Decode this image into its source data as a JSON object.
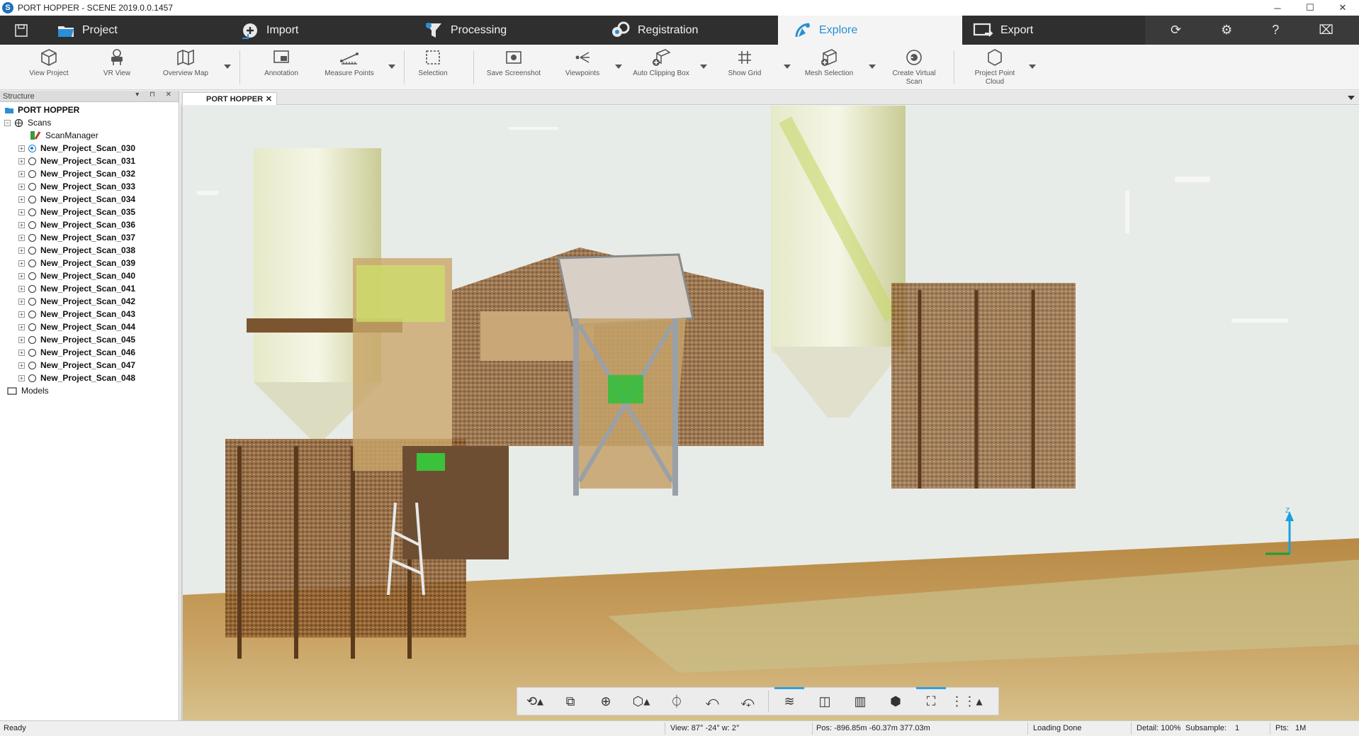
{
  "window": {
    "title": "PORT HOPPER - SCENE 2019.0.0.1457",
    "app_icon_letter": "S",
    "buttons": {
      "minimize": "─",
      "maximize": "☐",
      "close": "✕"
    }
  },
  "workflow": {
    "tabs": [
      {
        "label": "Project",
        "icon": "folder-icon"
      },
      {
        "label": "Import",
        "icon": "import-icon"
      },
      {
        "label": "Processing",
        "icon": "processing-icon"
      },
      {
        "label": "Registration",
        "icon": "registration-icon"
      },
      {
        "label": "Explore",
        "icon": "explore-icon",
        "active": true
      },
      {
        "label": "Export",
        "icon": "export-icon"
      }
    ],
    "right_tools": [
      "sync-icon",
      "gear-icon",
      "help-icon",
      "camera-icon"
    ],
    "accent_color": "#2a8fd6"
  },
  "ribbon": {
    "view_project": "View Project",
    "vr_view": "VR View",
    "overview_map": "Overview Map",
    "annotation": "Annotation",
    "measure_points": "Measure Points",
    "selection": "Selection",
    "save_screenshot": "Save Screenshot",
    "viewpoints": "Viewpoints",
    "auto_clipping_box": "Auto Clipping Box",
    "show_grid": "Show Grid",
    "mesh_selection": "Mesh Selection",
    "create_virtual_scan_1": "Create Virtual",
    "create_virtual_scan_2": "Scan",
    "project_point_cloud_1": "Project Point",
    "project_point_cloud_2": "Cloud"
  },
  "structure": {
    "title": "Structure",
    "header_buttons": "▾ ⊓ ✕",
    "root": "PORT HOPPER",
    "scans_folder": "Scans",
    "scan_manager": "ScanManager",
    "scans": [
      "New_Project_Scan_030",
      "New_Project_Scan_031",
      "New_Project_Scan_032",
      "New_Project_Scan_033",
      "New_Project_Scan_034",
      "New_Project_Scan_035",
      "New_Project_Scan_036",
      "New_Project_Scan_037",
      "New_Project_Scan_038",
      "New_Project_Scan_039",
      "New_Project_Scan_040",
      "New_Project_Scan_041",
      "New_Project_Scan_042",
      "New_Project_Scan_043",
      "New_Project_Scan_044",
      "New_Project_Scan_045",
      "New_Project_Scan_046",
      "New_Project_Scan_047",
      "New_Project_Scan_048"
    ],
    "selected_scan": "New_Project_Scan_030",
    "models_folder": "Models"
  },
  "view_tab": {
    "label": "PORT HOPPER",
    "close": "✕"
  },
  "axis": {
    "z": "Z"
  },
  "navbar": {
    "buttons": [
      "orbit-mode-icon",
      "walk-mode-icon",
      "zoom-icon",
      "view-cube-icon",
      "rotate-axis-icon",
      "pan-view-icon",
      "fly-mode-icon",
      "clipping-icon",
      "mirror-view-icon",
      "depth-icon",
      "box-view-icon",
      "fit-view-icon",
      "grid-menu-icon"
    ]
  },
  "status": {
    "ready": "Ready",
    "view": "View: 87° -24° w: 2°",
    "pos": "Pos: -896.85m -60.37m 377.03m",
    "loading": "Loading Done",
    "detail": "Detail: 100%",
    "subsample_label": "Subsample:",
    "subsample_value": "1",
    "pts_label": "Pts:",
    "pts_value": "1M"
  }
}
